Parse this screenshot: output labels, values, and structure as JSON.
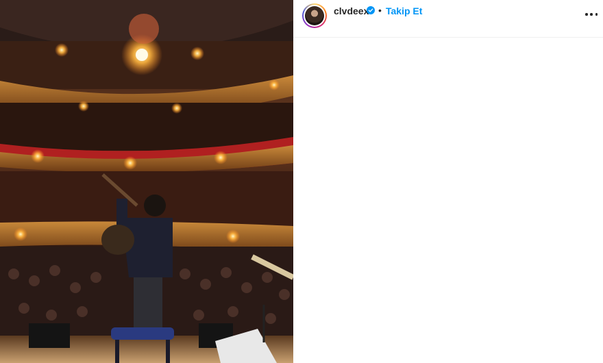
{
  "post": {
    "image_alt": "Concert stage view of a guitarist facing a packed theater audience",
    "author": {
      "username": "clvdeex",
      "verified": true,
      "follow_label": "Takip Et",
      "separator": "•"
    }
  },
  "colors": {
    "link_blue": "#0095f6",
    "verified_blue": "#0095f6",
    "text_primary": "#262626",
    "divider": "#efefef"
  },
  "icons": [
    "verified-badge-icon",
    "more-options-icon"
  ]
}
